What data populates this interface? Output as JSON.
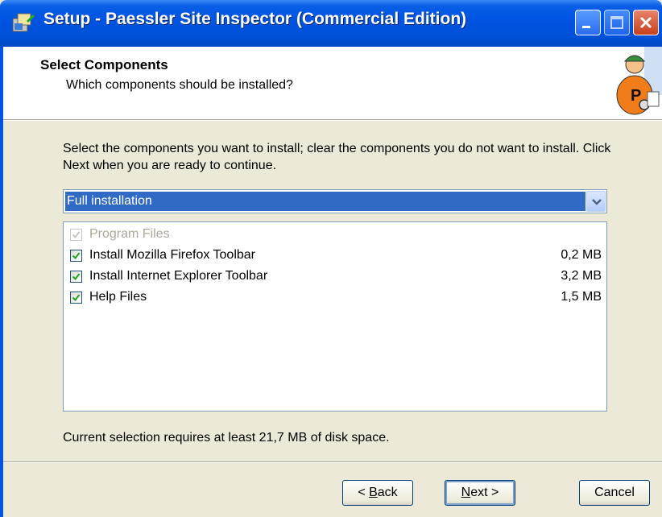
{
  "window": {
    "title": "Setup - Paessler Site Inspector (Commercial Edition)",
    "icon": "setup-icon",
    "controls": [
      "minimize-icon",
      "maximize-icon",
      "close-icon"
    ]
  },
  "header": {
    "title": "Select Components",
    "subtitle": "Which components should be installed?",
    "logo": "paessler-mascot-icon"
  },
  "body": {
    "description": "Select the components you want to install; clear the components you do not want to install. Click Next when you are ready to continue.",
    "install_type": {
      "selected": "Full installation"
    },
    "components": [
      {
        "label": "Program Files",
        "size": "",
        "checked": true,
        "enabled": false
      },
      {
        "label": "Install Mozilla Firefox Toolbar",
        "size": "0,2 MB",
        "checked": true,
        "enabled": true
      },
      {
        "label": "Install Internet Explorer Toolbar",
        "size": "3,2 MB",
        "checked": true,
        "enabled": true
      },
      {
        "label": "Help Files",
        "size": "1,5 MB",
        "checked": true,
        "enabled": true
      }
    ],
    "status": "Current selection requires at least 21,7 MB of disk space."
  },
  "buttons": {
    "back": {
      "prefix": "< ",
      "accel": "B",
      "rest": "ack"
    },
    "next": {
      "accel": "N",
      "rest": "ext >"
    },
    "cancel": "Cancel"
  },
  "colors": {
    "titlebar": "#0054e3",
    "selection": "#316ac5",
    "check": "#21a121",
    "background": "#ece9d8"
  }
}
